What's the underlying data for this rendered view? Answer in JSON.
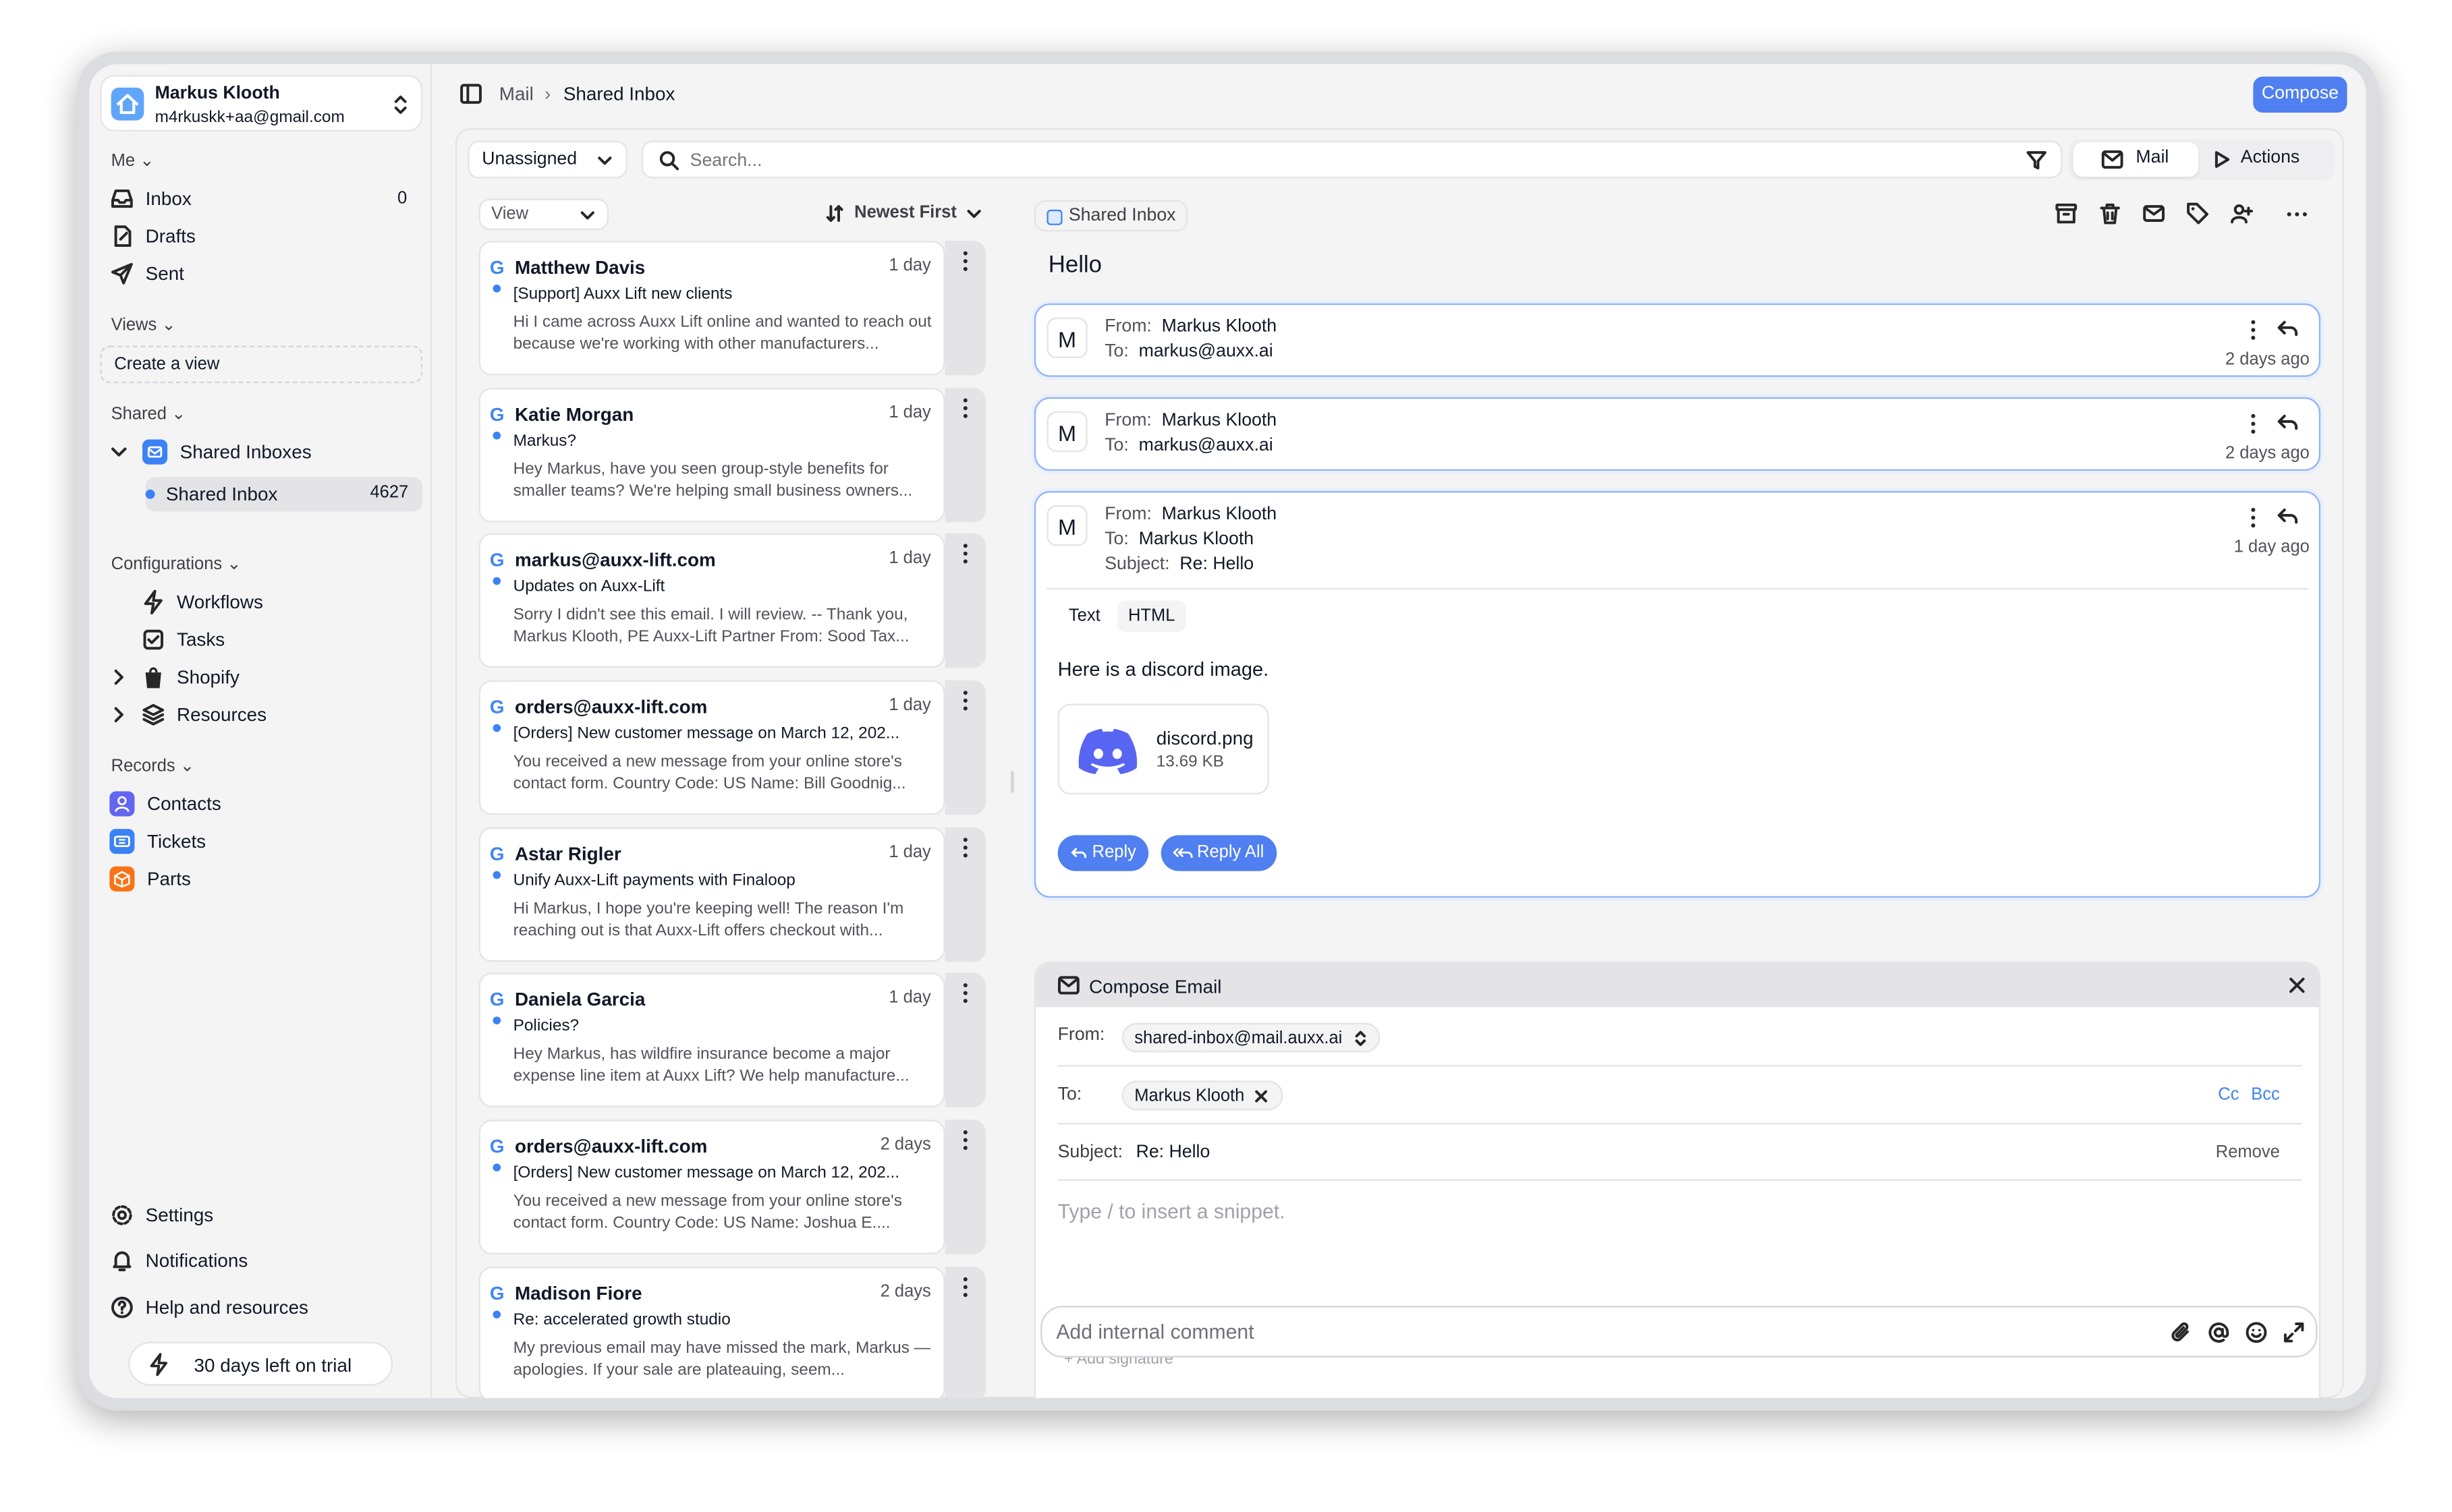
{
  "account": {
    "name": "Markus Klooth",
    "email": "m4rkuskk+aa@gmail.com"
  },
  "sidebar": {
    "me_label": "Me",
    "inbox": {
      "label": "Inbox",
      "count": "0"
    },
    "drafts": "Drafts",
    "sent": "Sent",
    "views_label": "Views",
    "create_view": "Create a view",
    "shared_label": "Shared",
    "shared_inboxes": "Shared Inboxes",
    "shared_inbox": {
      "label": "Shared Inbox",
      "count": "4627"
    },
    "configurations_label": "Configurations",
    "workflows": "Workflows",
    "tasks": "Tasks",
    "shopify": "Shopify",
    "resources": "Resources",
    "records_label": "Records",
    "contacts": "Contacts",
    "tickets": "Tickets",
    "parts": "Parts",
    "settings": "Settings",
    "notifications": "Notifications",
    "help": "Help and resources",
    "trial": "30 days left on trial"
  },
  "breadcrumb": {
    "root": "Mail",
    "current": "Shared Inbox"
  },
  "compose_button": "Compose",
  "toolbar": {
    "filter_value": "Unassigned",
    "search_placeholder": "Search...",
    "mail_tab": "Mail",
    "actions_tab": "Actions"
  },
  "list": {
    "view_label": "View",
    "sort_label": "Newest First",
    "items": [
      {
        "sender": "Matthew Davis",
        "time": "1 day",
        "subject": "[Support] Auxx Lift new clients",
        "preview": "Hi I came across Auxx Lift online and wanted to reach out because we're working with other manufacturers..."
      },
      {
        "sender": "Katie Morgan",
        "time": "1 day",
        "subject": "Markus?",
        "preview": "Hey Markus, have you seen group-style benefits for smaller teams? We're helping small business owners..."
      },
      {
        "sender": "markus@auxx-lift.com",
        "time": "1 day",
        "subject": "Updates on Auxx-Lift",
        "preview": "Sorry I didn't see this email. I will review. -- Thank you, Markus Klooth, PE Auxx-Lift Partner From: Sood Tax..."
      },
      {
        "sender": "orders@auxx-lift.com",
        "time": "1 day",
        "subject": "[Orders] New customer message on March 12, 202...",
        "preview": "You received a new message from your online store's contact form. Country Code: US Name: Bill Goodnig..."
      },
      {
        "sender": "Astar Rigler",
        "time": "1 day",
        "subject": "Unify Auxx-Lift payments with Finaloop",
        "preview": "Hi Markus, I hope you're keeping well! The reason I'm reaching out is that Auxx-Lift offers checkout with..."
      },
      {
        "sender": "Daniela Garcia",
        "time": "1 day",
        "subject": "Policies?",
        "preview": "Hey Markus, has wildfire insurance become a major expense line item at Auxx Lift? We help manufacture..."
      },
      {
        "sender": "orders@auxx-lift.com",
        "time": "2 days",
        "subject": "[Orders] New customer message on March 12, 202...",
        "preview": "You received a new message from your online store's contact form. Country Code: US Name: Joshua E...."
      },
      {
        "sender": "Madison Fiore",
        "time": "2 days",
        "subject": "Re: accelerated growth studio",
        "preview": "My previous email may have missed the mark, Markus —apologies. If your sale are plateauing, seem..."
      }
    ]
  },
  "thread": {
    "tag": "Shared Inbox",
    "subject": "Hello",
    "messages": [
      {
        "avatar": "M",
        "from_label": "From:",
        "from": "Markus Klooth",
        "to_label": "To:",
        "to": "markus@auxx.ai",
        "ago": "2 days ago"
      },
      {
        "avatar": "M",
        "from_label": "From:",
        "from": "Markus Klooth",
        "to_label": "To:",
        "to": "markus@auxx.ai",
        "ago": "2 days ago"
      },
      {
        "avatar": "M",
        "from_label": "From:",
        "from": "Markus Klooth",
        "to_label": "To:",
        "to": "Markus Klooth",
        "subject_label": "Subject:",
        "subject": "Re: Hello",
        "ago": "1 day ago",
        "tab_text": "Text",
        "tab_html": "HTML",
        "body": "Here is a discord image.",
        "attachment": {
          "name": "discord.png",
          "size": "13.69 KB"
        },
        "reply": "Reply",
        "reply_all": "Reply All"
      }
    ]
  },
  "composer": {
    "title": "Compose Email",
    "from_label": "From:",
    "from_value": "shared-inbox@mail.auxx.ai",
    "to_label": "To:",
    "to_value": "Markus Klooth",
    "cc": "Cc",
    "bcc": "Bcc",
    "subject_label": "Subject:",
    "subject_value": "Re: Hello",
    "remove": "Remove",
    "body_placeholder": "Type / to insert a snippet.",
    "comment_placeholder": "Add internal comment",
    "add_signature": "+ Add signature"
  },
  "colors": {
    "accent": "#4f7ff0",
    "discord": "#5865f2",
    "contacts": "#6366f1",
    "tickets": "#3b82f6",
    "parts": "#f97316"
  }
}
